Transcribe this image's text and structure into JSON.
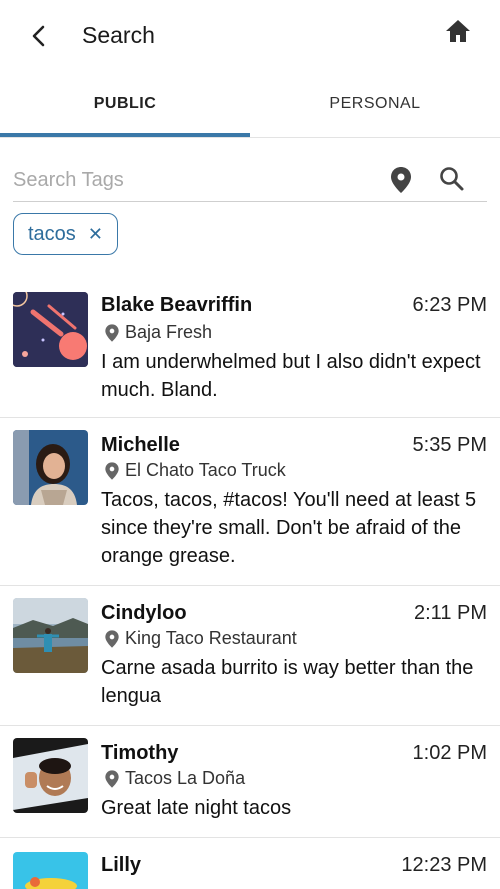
{
  "header": {
    "title": "Search"
  },
  "tabs": [
    {
      "label": "PUBLIC"
    },
    {
      "label": "PERSONAL"
    }
  ],
  "search": {
    "placeholder": "Search Tags",
    "value": ""
  },
  "chips": [
    {
      "label": "tacos",
      "close": "✕"
    }
  ],
  "posts": [
    {
      "name": "Blake Beavriffin",
      "time": "6:23 PM",
      "place": "Baja Fresh",
      "text": "I am underwhelmed but I also didn't expect much. Bland."
    },
    {
      "name": "Michelle",
      "time": "5:35 PM",
      "place": "El Chato Taco Truck",
      "text": "Tacos, tacos, #tacos! You'll need at least 5 since they're small. Don't be afraid of the orange grease."
    },
    {
      "name": "Cindyloo",
      "time": "2:11 PM",
      "place": "King Taco Restaurant",
      "text": "Carne asada burrito is way better than the lengua"
    },
    {
      "name": "Timothy",
      "time": "1:02 PM",
      "place": "Tacos La Doña",
      "text": "Great late night tacos"
    },
    {
      "name": "Lilly",
      "time": "12:23 PM",
      "place": "",
      "text": ""
    }
  ],
  "colors": {
    "accent": "#3a78a8",
    "chip_text": "#2e6d9c",
    "divider": "#e3e3e3"
  },
  "icons": [
    "back-arrow-icon",
    "home-icon",
    "location-pin-icon",
    "search-icon",
    "close-icon"
  ]
}
